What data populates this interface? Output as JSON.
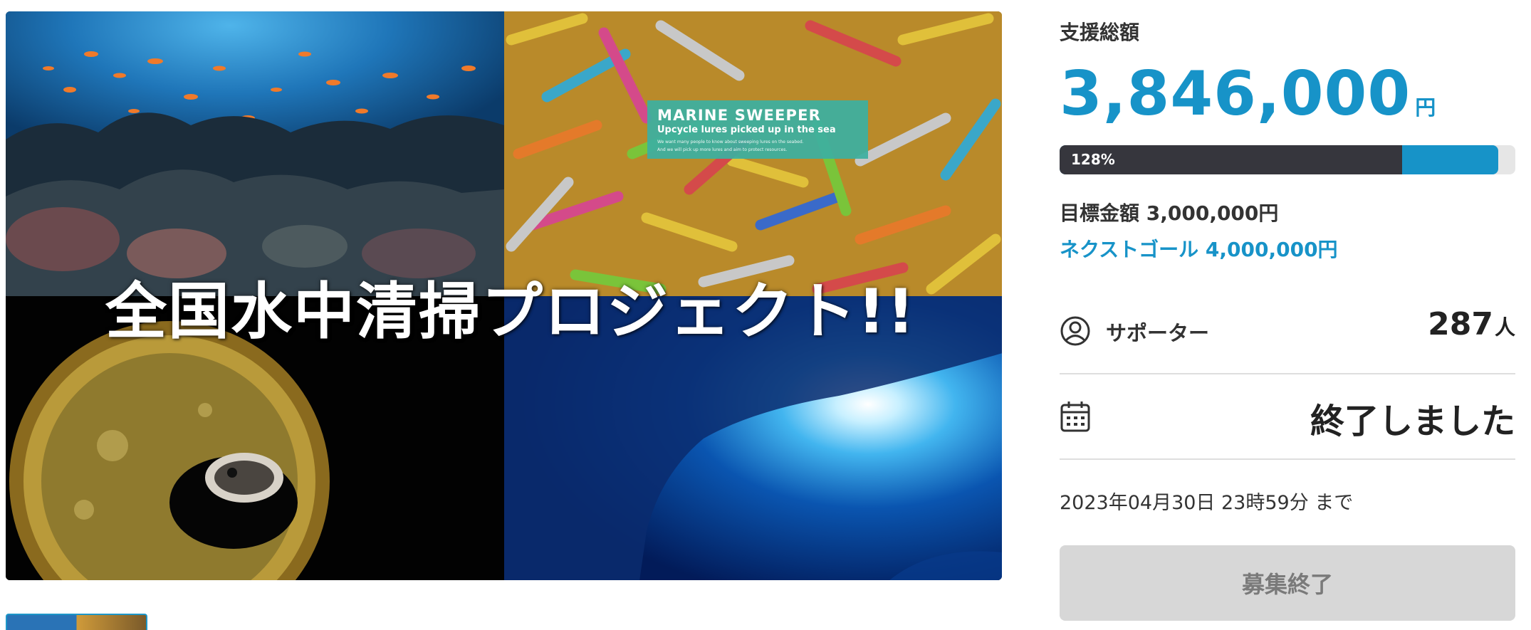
{
  "hero": {
    "title": "全国水中清掃プロジェクト!!",
    "badge": {
      "title": "MARINE SWEEPER",
      "subtitle": "Upcycle lures picked up in the sea",
      "fine_print_1": "We want many people to know about sweeping lures on the seabed.",
      "fine_print_2": "And we will pick up more lures and aim to protect resources."
    }
  },
  "funding": {
    "label": "支援総額",
    "amount": "3,846,000",
    "unit": "円",
    "progress_label": "128%",
    "progress_percent": 128,
    "goal": "目標金額 3,000,000円",
    "next_goal": "ネクストゴール 4,000,000円"
  },
  "supporters": {
    "label": "サポーター",
    "count": "287",
    "unit": "人",
    "icon": "user-circle-icon"
  },
  "status": {
    "icon": "calendar-icon",
    "text": "終了しました",
    "deadline": "2023年04月30日 23時59分 まで"
  },
  "action": {
    "button_label": "募集終了"
  },
  "colors": {
    "accent": "#1793c8",
    "dark_bar": "#36363d",
    "button_disabled": "#d7d7d7"
  }
}
